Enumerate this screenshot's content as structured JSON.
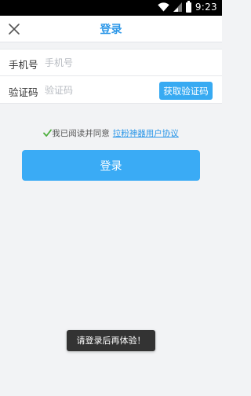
{
  "status_bar": {
    "time": "9:23"
  },
  "header": {
    "title": "登录",
    "close_icon": "close-icon"
  },
  "form": {
    "phone": {
      "label": "手机号",
      "placeholder": "手机号",
      "value": ""
    },
    "code": {
      "label": "验证码",
      "placeholder": "验证码",
      "value": "",
      "button_label": "获取验证码"
    }
  },
  "agreement": {
    "text": "我已阅读并同意",
    "link_text": "拉粉神器用户协议",
    "checked": true
  },
  "login_button": {
    "label": "登录"
  },
  "toast": {
    "text": "请登录后再体验！"
  },
  "colors": {
    "accent": "#37aaf2",
    "title": "#2c97e8",
    "check": "#4cae3c"
  }
}
